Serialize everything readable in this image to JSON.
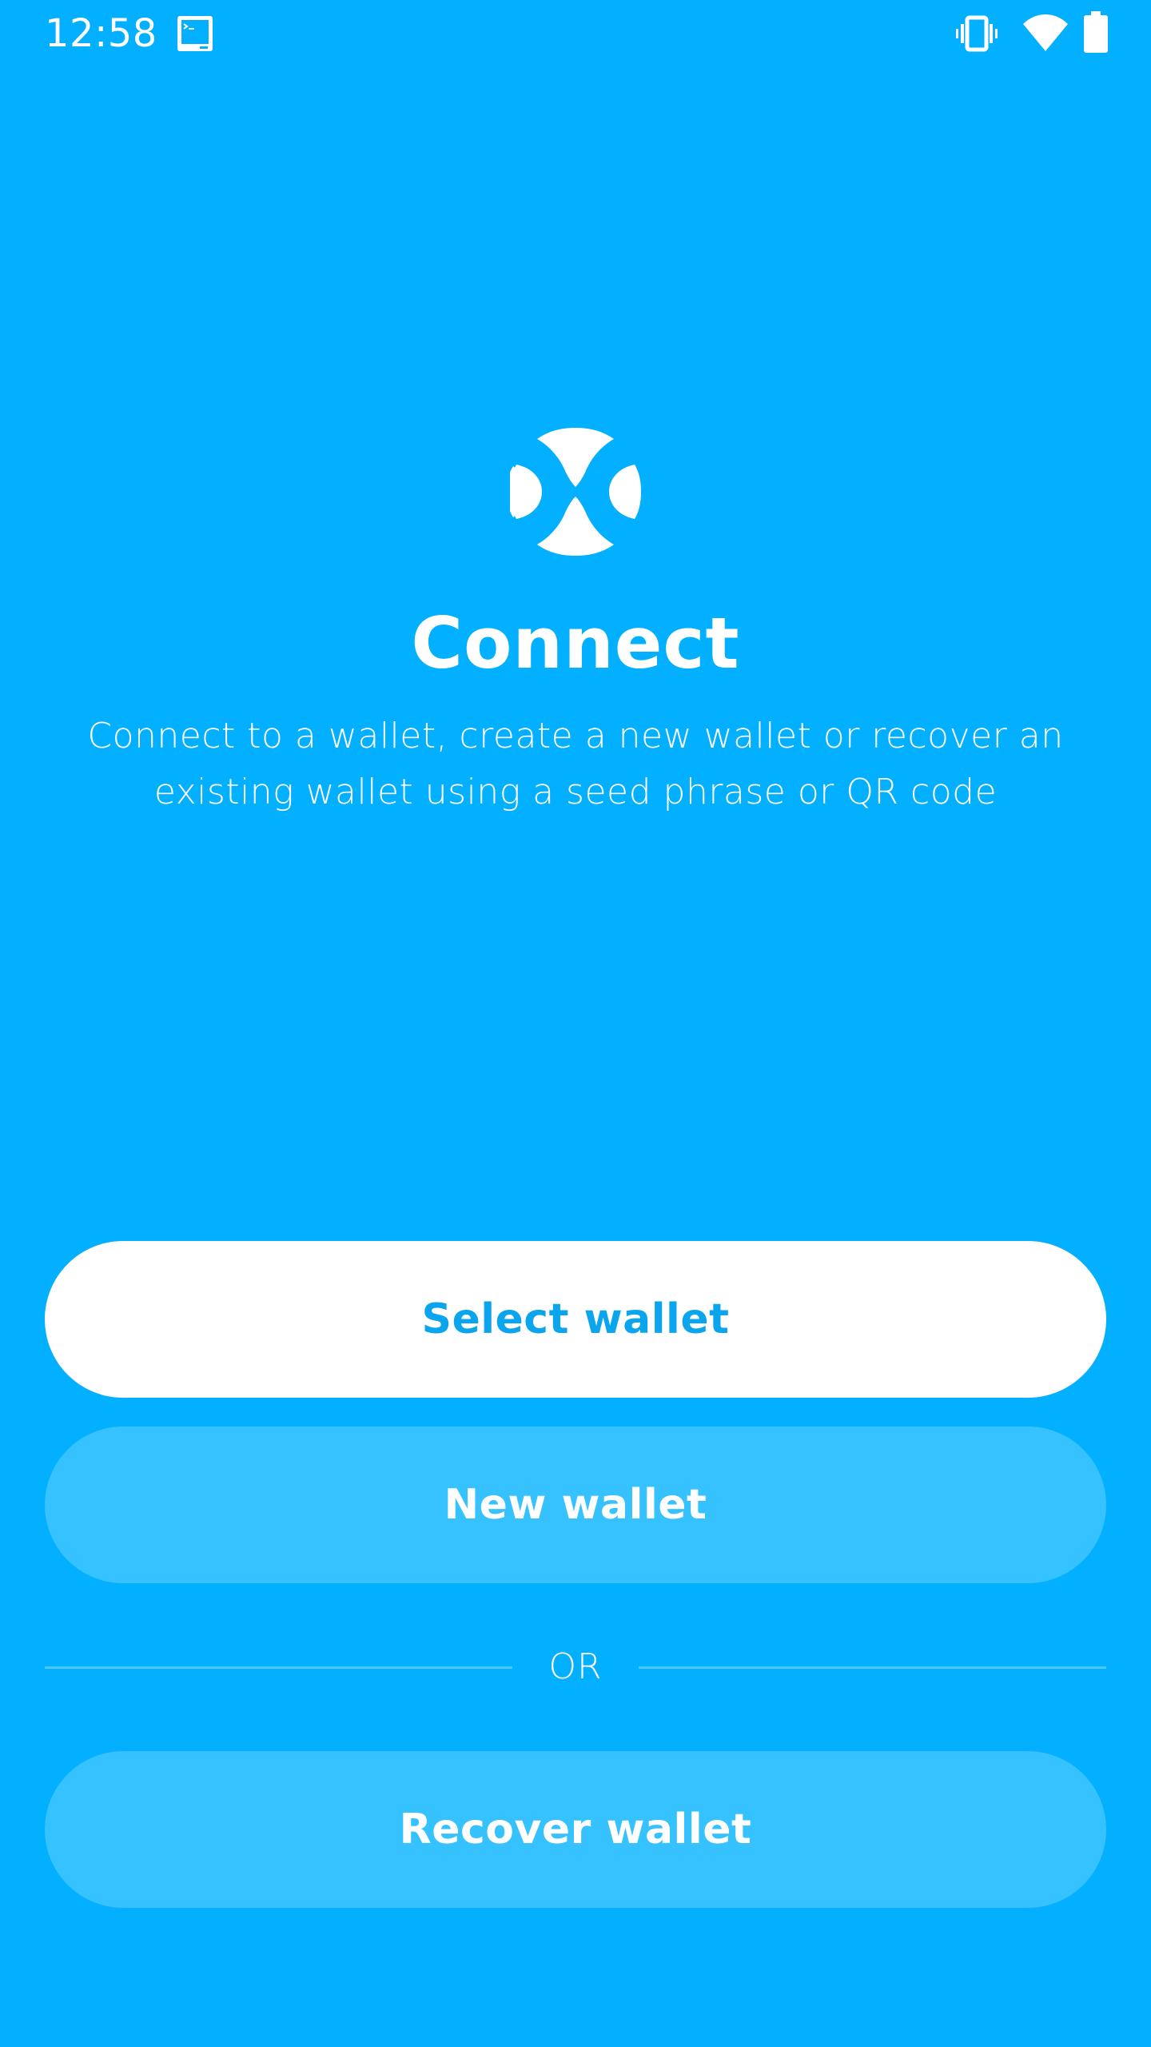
{
  "status_bar": {
    "time": "12:58",
    "icons": [
      "terminal-icon",
      "vibrate-icon",
      "wifi-icon",
      "battery-icon"
    ]
  },
  "hero": {
    "logo_icon": "wallet-connect-logo-icon",
    "title": "Connect",
    "description": "Connect to a wallet, create a new wallet or recover an existing wallet using a seed phrase or QR code"
  },
  "actions": {
    "select_wallet": "Select wallet",
    "new_wallet": "New wallet",
    "divider_label": "OR",
    "recover_wallet": "Recover wallet"
  },
  "colors": {
    "background": "#03AFFF",
    "primary_button_bg": "#FFFFFF",
    "primary_button_text": "#0AA5EC",
    "secondary_button_bg": "#36C1FF",
    "divider_line": "#4CC5FC"
  }
}
